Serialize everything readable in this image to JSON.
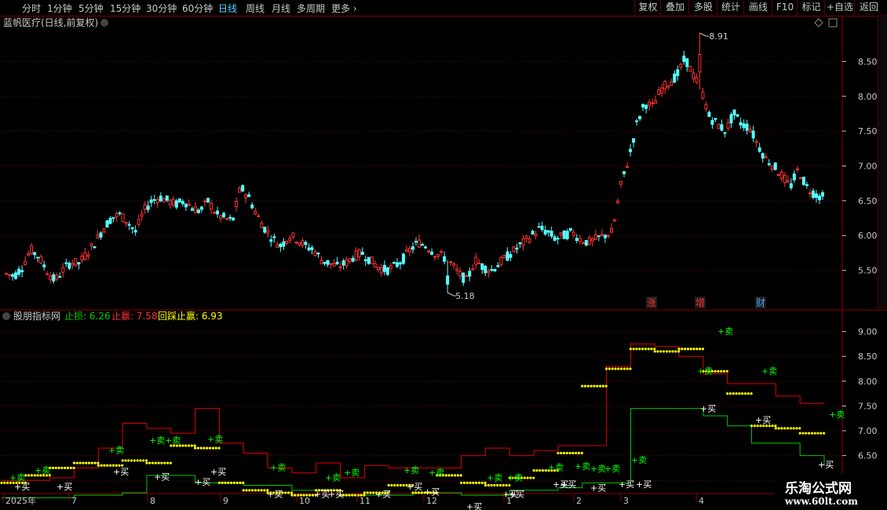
{
  "toolbar": {
    "periods": [
      "分时",
      "1分钟",
      "5分钟",
      "15分钟",
      "30分钟",
      "60分钟",
      "日线",
      "周线",
      "月线",
      "多周期",
      "更多"
    ],
    "active_period": "日线",
    "right_buttons": [
      "复权",
      "叠加",
      "多股",
      "统计",
      "画线",
      "F10",
      "标记",
      "+自选",
      "返回"
    ]
  },
  "main_panel": {
    "title": "蓝帆医疗(日线,前复权)",
    "price_high_label": "8.91",
    "price_low_label": "5.18",
    "event_markers": [
      {
        "text": "涨",
        "color": "#ff3030"
      },
      {
        "text": "增",
        "color": "#ff3030"
      },
      {
        "text": "财",
        "color": "#4aa0ff"
      }
    ]
  },
  "indicator_panel": {
    "name": "股朋指标网",
    "stop_loss_label": "止损:",
    "stop_loss_value": "6.26",
    "take_profit_label": "止赢:",
    "take_profit_value": "7.58",
    "pullback_label": "回踩止赢:",
    "pullback_value": "6.93",
    "buy_label": "+买",
    "sell_label": "+卖"
  },
  "watermark": {
    "title": "乐淘公式网",
    "url": "www.60lt.com"
  },
  "colors": {
    "up": "#ff3232",
    "down": "#54ffff",
    "stop_loss": "#00c800",
    "take_profit": "#e00000",
    "pullback": "#ffff00",
    "grid": "#8b0000",
    "buy": "#ffffff",
    "sell": "#00ff00"
  },
  "chart_data": [
    {
      "type": "candlestick",
      "title": "蓝帆医疗(日线,前复权)",
      "ylim": [
        5.18,
        8.91
      ],
      "y_ticks": [
        5.5,
        6.0,
        6.5,
        7.0,
        7.5,
        8.0,
        8.5
      ],
      "x_ticks": [
        "2025年",
        "7",
        "8",
        "9",
        "10",
        "11",
        "12",
        "1",
        "2",
        "3",
        "4"
      ],
      "close": [
        5.45,
        5.42,
        5.55,
        5.8,
        5.7,
        5.5,
        5.35,
        5.5,
        5.62,
        5.6,
        5.75,
        5.9,
        6.1,
        6.25,
        6.3,
        6.2,
        6.05,
        6.35,
        6.5,
        6.55,
        6.5,
        6.45,
        6.5,
        6.4,
        6.35,
        6.5,
        6.3,
        6.25,
        6.2,
        6.7,
        6.55,
        6.3,
        6.1,
        5.95,
        5.85,
        6.0,
        5.95,
        5.85,
        5.8,
        5.65,
        5.6,
        5.55,
        5.6,
        5.7,
        5.75,
        5.65,
        5.55,
        5.5,
        5.55,
        5.65,
        5.8,
        5.9,
        5.85,
        5.75,
        5.7,
        5.6,
        5.45,
        5.35,
        5.65,
        5.55,
        5.5,
        5.6,
        5.7,
        5.8,
        5.9,
        6.0,
        6.1,
        6.05,
        5.95,
        6.0,
        6.05,
        5.95,
        5.9,
        5.95,
        6.0,
        6.05,
        6.7,
        7.1,
        7.6,
        7.9,
        7.85,
        8.1,
        8.2,
        8.3,
        8.55,
        8.3,
        8.1,
        7.7,
        7.6,
        7.5,
        7.75,
        7.6,
        7.55,
        7.3,
        7.1,
        7.0,
        6.85,
        6.7,
        6.95,
        6.7,
        6.6,
        6.55
      ],
      "last_price_shown": 6.5
    },
    {
      "type": "line",
      "title": "股朋指标网",
      "ylim": [
        5.75,
        9.2
      ],
      "y_ticks": [
        6.0,
        6.5,
        7.0,
        7.5,
        8.0,
        8.5,
        9.0
      ],
      "series": [
        {
          "name": "止损",
          "color": "#00c800",
          "values": [
            5.65,
            5.65,
            5.65,
            5.7,
            5.7,
            5.75,
            6.1,
            6.1,
            5.95,
            5.95,
            5.9,
            5.9,
            5.8,
            5.8,
            5.7,
            5.7,
            5.7,
            5.75,
            5.75,
            5.7,
            5.7,
            5.8,
            5.8,
            5.85,
            5.95,
            5.95,
            7.45,
            7.45,
            7.45,
            7.3,
            7.1,
            6.75,
            6.75,
            6.5,
            6.3
          ],
          "points": [
            "start",
            "jul",
            "jul2",
            "jul3",
            "jul4",
            "aug",
            "aug2",
            "aug3",
            "sep",
            "sep2",
            "sep3",
            "oct",
            "oct2",
            "nov",
            "nov2",
            "dec",
            "dec2",
            "dec3",
            "jan",
            "jan2",
            "jan3",
            "feb",
            "feb2",
            "mar",
            "mar2",
            "mar3",
            "apr",
            "apr2",
            "apr3",
            "apr4",
            "may",
            "may2",
            "may3",
            "may4",
            "end"
          ]
        },
        {
          "name": "止赢",
          "color": "#e00000",
          "values": [
            6.0,
            6.0,
            6.05,
            6.25,
            6.65,
            7.15,
            7.05,
            6.95,
            7.45,
            6.75,
            6.55,
            6.25,
            6.15,
            6.35,
            6.05,
            6.3,
            6.25,
            6.25,
            6.25,
            6.5,
            6.65,
            6.5,
            6.6,
            6.7,
            6.7,
            8.3,
            8.75,
            8.7,
            8.5,
            8.15,
            7.95,
            7.95,
            7.7,
            7.55,
            7.55
          ]
        },
        {
          "name": "回踩止赢",
          "color": "#ffff00",
          "values": [
            5.95,
            6.1,
            6.25,
            6.35,
            6.3,
            6.4,
            6.35,
            6.7,
            6.65,
            5.95,
            5.8,
            5.75,
            5.7,
            5.8,
            5.7,
            5.75,
            5.9,
            5.75,
            6.1,
            5.95,
            5.9,
            6.05,
            6.2,
            6.55,
            7.9,
            8.25,
            8.65,
            8.6,
            8.65,
            8.2,
            7.75,
            7.1,
            7.05,
            6.95,
            6.93
          ]
        }
      ]
    }
  ]
}
